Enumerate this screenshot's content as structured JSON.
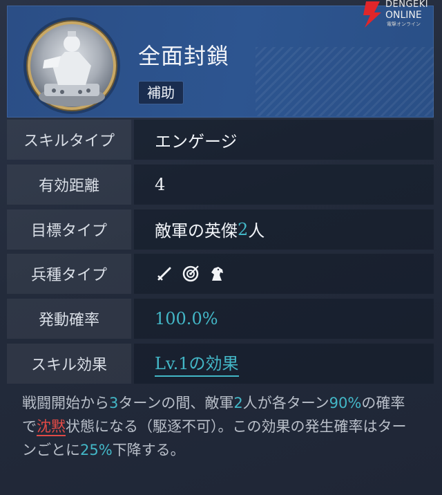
{
  "skill": {
    "name": "全面封鎖",
    "category": "補助"
  },
  "rows": [
    {
      "label": "スキルタイプ",
      "value": "エンゲージ"
    },
    {
      "label": "有効距離",
      "value": "4"
    },
    {
      "label": "目標タイプ",
      "value_prefix": "敵軍の英傑",
      "value_number": "2",
      "value_suffix": "人"
    },
    {
      "label": "兵種タイプ",
      "icons": [
        "sword-icon",
        "bow-target-icon",
        "horse-icon"
      ]
    },
    {
      "label": "発動確率",
      "value": "100.0%"
    },
    {
      "label": "スキル効果",
      "value": "Lv.1の効果"
    }
  ],
  "description": {
    "p1": "戦闘開始から",
    "n1": "3",
    "p2": "ターンの間、敵軍",
    "n2": "2",
    "p3": "人が各ターン",
    "n3": "90%",
    "p4": "の確率で",
    "status": "沈黙",
    "p5": "状態になる（駆逐不可）。この効果の発生確率はターンごとに",
    "n4": "25%",
    "p6": "下降する。"
  },
  "watermark": {
    "line1": "DENGEKI",
    "line2": "ONLINE",
    "line3": "電撃オンライン"
  },
  "colors": {
    "accent": "#43b7c7",
    "status": "#e14a46",
    "header": "#2b4e86"
  }
}
